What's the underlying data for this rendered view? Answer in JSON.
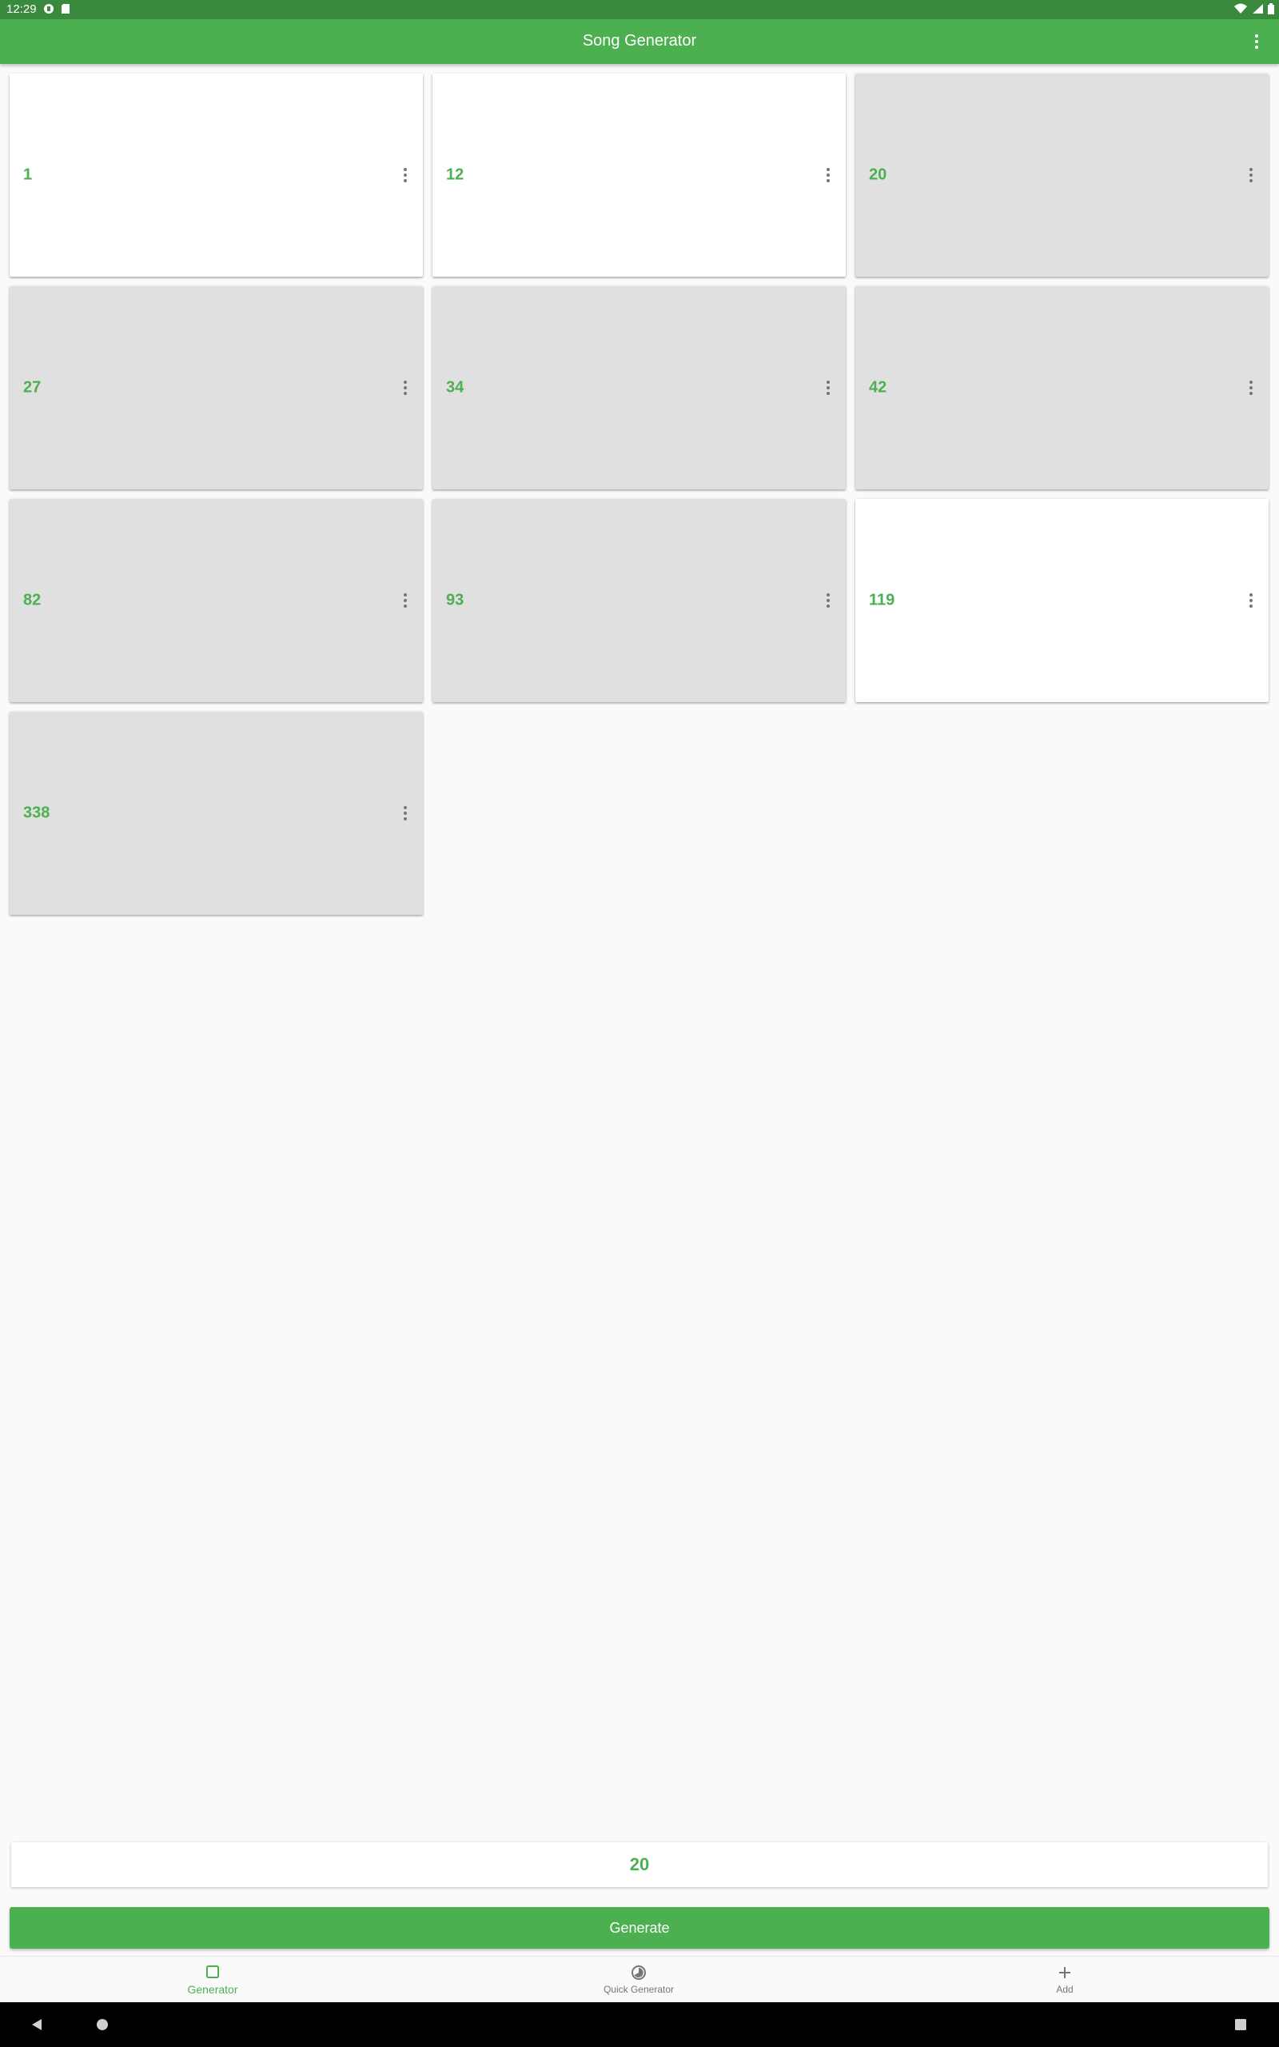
{
  "status_bar": {
    "time": "12:29",
    "icons_left": [
      "cast-icon",
      "sd-card-icon"
    ],
    "icons_right": [
      "wifi-icon",
      "signal-icon",
      "battery-icon"
    ]
  },
  "app_bar": {
    "title": "Song Generator",
    "menu_icon": "more-vert-icon"
  },
  "songs": [
    {
      "number": "1",
      "selected": false
    },
    {
      "number": "12",
      "selected": false
    },
    {
      "number": "20",
      "selected": true
    },
    {
      "number": "27",
      "selected": true
    },
    {
      "number": "34",
      "selected": true
    },
    {
      "number": "42",
      "selected": true
    },
    {
      "number": "82",
      "selected": true
    },
    {
      "number": "93",
      "selected": true
    },
    {
      "number": "119",
      "selected": false
    },
    {
      "number": "338",
      "selected": true
    }
  ],
  "result": {
    "value": "20"
  },
  "generate_button": {
    "label": "Generate"
  },
  "bottom_nav": {
    "items": [
      {
        "label": "Generator",
        "icon": "square-outline-icon",
        "active": true
      },
      {
        "label": "Quick Generator",
        "icon": "timer-icon",
        "active": false
      },
      {
        "label": "Add",
        "icon": "plus-icon",
        "active": false
      }
    ]
  },
  "colors": {
    "primary": "#4caf50",
    "primary_dark": "#3a8a3d",
    "card_selected": "#e0e0e0",
    "card_unselected": "#ffffff"
  }
}
